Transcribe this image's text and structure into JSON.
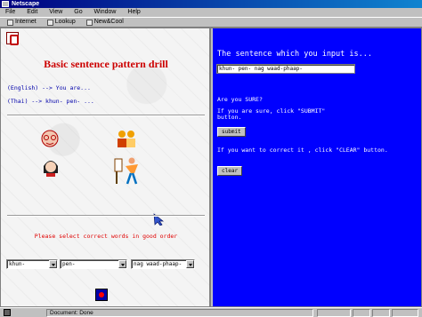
{
  "window": {
    "title": "Netscape"
  },
  "menu": [
    "File",
    "Edit",
    "View",
    "Go",
    "Window",
    "Help"
  ],
  "toolbar": [
    {
      "label": "Internet",
      "icon": "internet-icon"
    },
    {
      "label": "Lookup",
      "icon": "lookup-icon"
    },
    {
      "label": "New&Cool",
      "icon": "new-cool-icon"
    }
  ],
  "left": {
    "heading": "Basic sentence pattern drill",
    "english_line": "(English) --> You are...",
    "thai_line": "(Thai)  --> khun- pen- ...",
    "prompt": "Please select correct words in good order",
    "selects": [
      "khun-",
      "pen-",
      "nag waad-phaap-"
    ]
  },
  "right": {
    "title": "The sentence which you input is...",
    "input_value": "khun- pen- nag waad-phaap-",
    "are_you_sure": "Are you SURE?",
    "if_sure_line1": "If you are sure, click \"SUBMIT\"",
    "if_sure_line2": "button.",
    "submit_label": "submit",
    "correct_line": "If you want to correct it , click \"CLEAR\" button.",
    "clear_label": "clear"
  },
  "status": {
    "text": "Document: Done"
  },
  "colors": {
    "heading": "#cc0000",
    "right_bg": "#0000ff",
    "prompt": "#e00000",
    "title_bar": "#000080"
  }
}
